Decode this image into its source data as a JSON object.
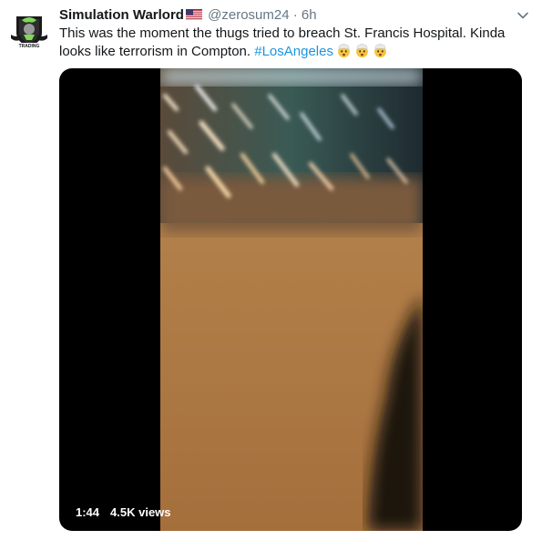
{
  "tweet": {
    "author_name": "Simulation Warlord",
    "handle": "@zerosum24",
    "separator": "·",
    "time": "6h",
    "text_main": "This was the moment the thugs tried to breach St. Francis Hospital. Kinda looks like terrorism in Compton. ",
    "hashtag": "#LosAngeles",
    "emoji_icons": [
      "exploding-head-emoji",
      "exploding-head-emoji",
      "exploding-head-emoji"
    ],
    "flag_icon": "us-flag-icon",
    "avatar_icon": "team-logo-avatar",
    "avatar_text": "TRADING"
  },
  "video": {
    "duration": "1:44",
    "views": "4.5K views"
  },
  "colors": {
    "hashtag": "#1b95e0",
    "meta": "#657786",
    "text": "#14171a"
  }
}
